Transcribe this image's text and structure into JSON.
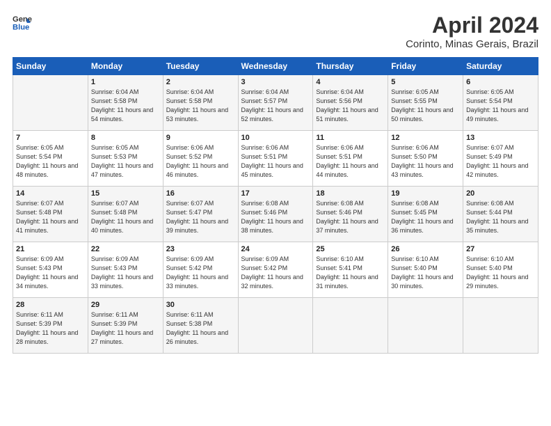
{
  "header": {
    "logo_line1": "General",
    "logo_line2": "Blue",
    "title": "April 2024",
    "location": "Corinto, Minas Gerais, Brazil"
  },
  "days_of_week": [
    "Sunday",
    "Monday",
    "Tuesday",
    "Wednesday",
    "Thursday",
    "Friday",
    "Saturday"
  ],
  "weeks": [
    [
      {
        "day": "",
        "sunrise": "",
        "sunset": "",
        "daylight": ""
      },
      {
        "day": "1",
        "sunrise": "Sunrise: 6:04 AM",
        "sunset": "Sunset: 5:58 PM",
        "daylight": "Daylight: 11 hours and 54 minutes."
      },
      {
        "day": "2",
        "sunrise": "Sunrise: 6:04 AM",
        "sunset": "Sunset: 5:58 PM",
        "daylight": "Daylight: 11 hours and 53 minutes."
      },
      {
        "day": "3",
        "sunrise": "Sunrise: 6:04 AM",
        "sunset": "Sunset: 5:57 PM",
        "daylight": "Daylight: 11 hours and 52 minutes."
      },
      {
        "day": "4",
        "sunrise": "Sunrise: 6:04 AM",
        "sunset": "Sunset: 5:56 PM",
        "daylight": "Daylight: 11 hours and 51 minutes."
      },
      {
        "day": "5",
        "sunrise": "Sunrise: 6:05 AM",
        "sunset": "Sunset: 5:55 PM",
        "daylight": "Daylight: 11 hours and 50 minutes."
      },
      {
        "day": "6",
        "sunrise": "Sunrise: 6:05 AM",
        "sunset": "Sunset: 5:54 PM",
        "daylight": "Daylight: 11 hours and 49 minutes."
      }
    ],
    [
      {
        "day": "7",
        "sunrise": "Sunrise: 6:05 AM",
        "sunset": "Sunset: 5:54 PM",
        "daylight": "Daylight: 11 hours and 48 minutes."
      },
      {
        "day": "8",
        "sunrise": "Sunrise: 6:05 AM",
        "sunset": "Sunset: 5:53 PM",
        "daylight": "Daylight: 11 hours and 47 minutes."
      },
      {
        "day": "9",
        "sunrise": "Sunrise: 6:06 AM",
        "sunset": "Sunset: 5:52 PM",
        "daylight": "Daylight: 11 hours and 46 minutes."
      },
      {
        "day": "10",
        "sunrise": "Sunrise: 6:06 AM",
        "sunset": "Sunset: 5:51 PM",
        "daylight": "Daylight: 11 hours and 45 minutes."
      },
      {
        "day": "11",
        "sunrise": "Sunrise: 6:06 AM",
        "sunset": "Sunset: 5:51 PM",
        "daylight": "Daylight: 11 hours and 44 minutes."
      },
      {
        "day": "12",
        "sunrise": "Sunrise: 6:06 AM",
        "sunset": "Sunset: 5:50 PM",
        "daylight": "Daylight: 11 hours and 43 minutes."
      },
      {
        "day": "13",
        "sunrise": "Sunrise: 6:07 AM",
        "sunset": "Sunset: 5:49 PM",
        "daylight": "Daylight: 11 hours and 42 minutes."
      }
    ],
    [
      {
        "day": "14",
        "sunrise": "Sunrise: 6:07 AM",
        "sunset": "Sunset: 5:48 PM",
        "daylight": "Daylight: 11 hours and 41 minutes."
      },
      {
        "day": "15",
        "sunrise": "Sunrise: 6:07 AM",
        "sunset": "Sunset: 5:48 PM",
        "daylight": "Daylight: 11 hours and 40 minutes."
      },
      {
        "day": "16",
        "sunrise": "Sunrise: 6:07 AM",
        "sunset": "Sunset: 5:47 PM",
        "daylight": "Daylight: 11 hours and 39 minutes."
      },
      {
        "day": "17",
        "sunrise": "Sunrise: 6:08 AM",
        "sunset": "Sunset: 5:46 PM",
        "daylight": "Daylight: 11 hours and 38 minutes."
      },
      {
        "day": "18",
        "sunrise": "Sunrise: 6:08 AM",
        "sunset": "Sunset: 5:46 PM",
        "daylight": "Daylight: 11 hours and 37 minutes."
      },
      {
        "day": "19",
        "sunrise": "Sunrise: 6:08 AM",
        "sunset": "Sunset: 5:45 PM",
        "daylight": "Daylight: 11 hours and 36 minutes."
      },
      {
        "day": "20",
        "sunrise": "Sunrise: 6:08 AM",
        "sunset": "Sunset: 5:44 PM",
        "daylight": "Daylight: 11 hours and 35 minutes."
      }
    ],
    [
      {
        "day": "21",
        "sunrise": "Sunrise: 6:09 AM",
        "sunset": "Sunset: 5:43 PM",
        "daylight": "Daylight: 11 hours and 34 minutes."
      },
      {
        "day": "22",
        "sunrise": "Sunrise: 6:09 AM",
        "sunset": "Sunset: 5:43 PM",
        "daylight": "Daylight: 11 hours and 33 minutes."
      },
      {
        "day": "23",
        "sunrise": "Sunrise: 6:09 AM",
        "sunset": "Sunset: 5:42 PM",
        "daylight": "Daylight: 11 hours and 33 minutes."
      },
      {
        "day": "24",
        "sunrise": "Sunrise: 6:09 AM",
        "sunset": "Sunset: 5:42 PM",
        "daylight": "Daylight: 11 hours and 32 minutes."
      },
      {
        "day": "25",
        "sunrise": "Sunrise: 6:10 AM",
        "sunset": "Sunset: 5:41 PM",
        "daylight": "Daylight: 11 hours and 31 minutes."
      },
      {
        "day": "26",
        "sunrise": "Sunrise: 6:10 AM",
        "sunset": "Sunset: 5:40 PM",
        "daylight": "Daylight: 11 hours and 30 minutes."
      },
      {
        "day": "27",
        "sunrise": "Sunrise: 6:10 AM",
        "sunset": "Sunset: 5:40 PM",
        "daylight": "Daylight: 11 hours and 29 minutes."
      }
    ],
    [
      {
        "day": "28",
        "sunrise": "Sunrise: 6:11 AM",
        "sunset": "Sunset: 5:39 PM",
        "daylight": "Daylight: 11 hours and 28 minutes."
      },
      {
        "day": "29",
        "sunrise": "Sunrise: 6:11 AM",
        "sunset": "Sunset: 5:39 PM",
        "daylight": "Daylight: 11 hours and 27 minutes."
      },
      {
        "day": "30",
        "sunrise": "Sunrise: 6:11 AM",
        "sunset": "Sunset: 5:38 PM",
        "daylight": "Daylight: 11 hours and 26 minutes."
      },
      {
        "day": "",
        "sunrise": "",
        "sunset": "",
        "daylight": ""
      },
      {
        "day": "",
        "sunrise": "",
        "sunset": "",
        "daylight": ""
      },
      {
        "day": "",
        "sunrise": "",
        "sunset": "",
        "daylight": ""
      },
      {
        "day": "",
        "sunrise": "",
        "sunset": "",
        "daylight": ""
      }
    ]
  ]
}
